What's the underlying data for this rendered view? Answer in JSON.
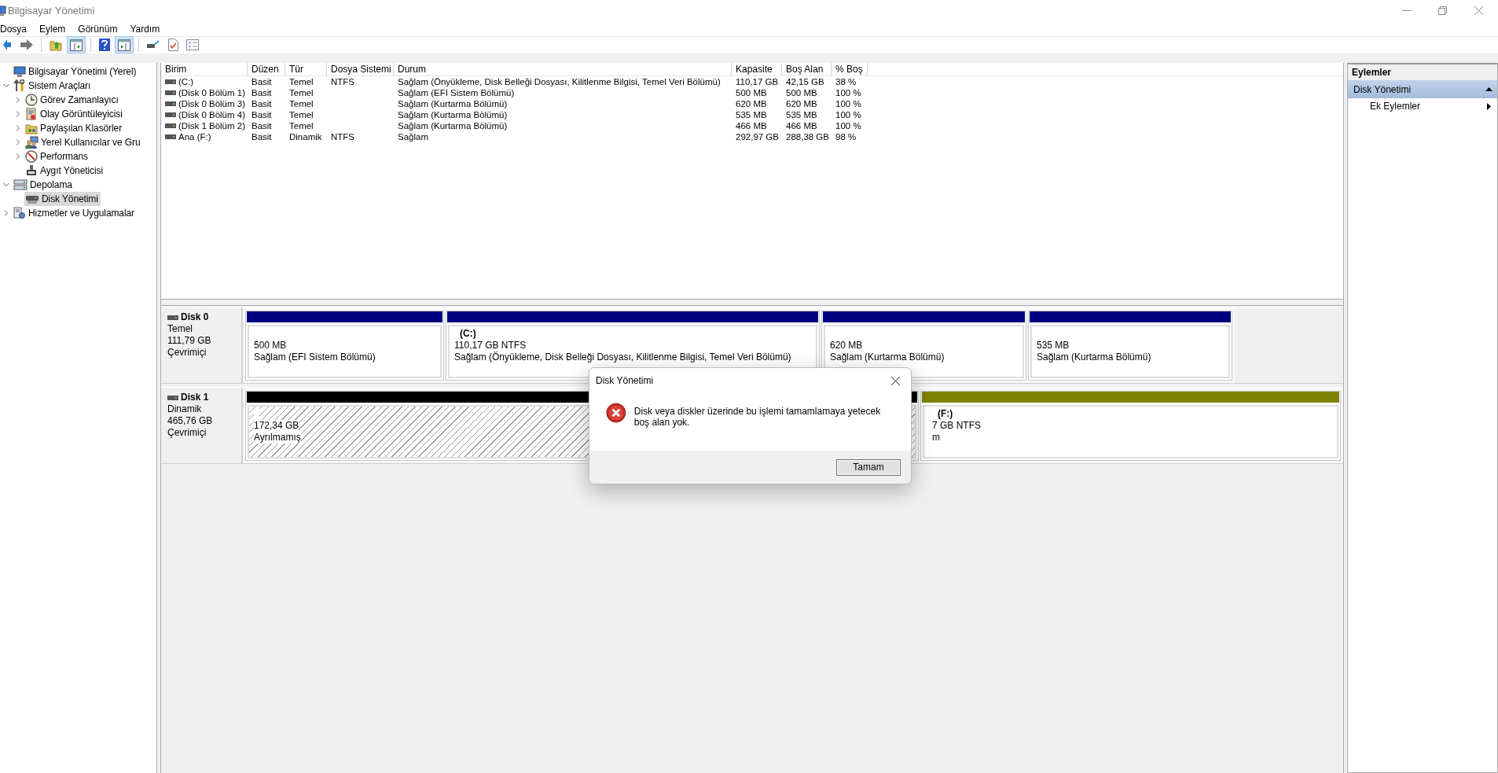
{
  "window": {
    "title": "Bilgisayar Yönetimi"
  },
  "menu": [
    "Dosya",
    "Eylem",
    "Görünüm",
    "Yardım"
  ],
  "toolbar": [
    {
      "pressed": false
    },
    {
      "pressed": false
    },
    {
      "pressed": false
    },
    {
      "pressed": true
    },
    {
      "pressed": false
    },
    {
      "pressed": true
    },
    {
      "pressed": false
    },
    {
      "pressed": false
    },
    {
      "pressed": false
    }
  ],
  "tree": [
    {
      "label": "Bilgisayar Yönetimi (Yerel)",
      "selected": false,
      "children": [
        {
          "label": "Sistem Araçları",
          "selected": false,
          "expanded": true,
          "children": [
            {
              "label": "Görev Zamanlayıcı",
              "selected": false,
              "expanded": false
            },
            {
              "label": "Olay Görüntüleyicisi",
              "selected": false,
              "expanded": false
            },
            {
              "label": "Paylaşılan Klasörler",
              "selected": false,
              "expanded": false
            },
            {
              "label": "Yerel Kullanıcılar ve Gru",
              "selected": false,
              "expanded": false
            },
            {
              "label": "Performans",
              "selected": false,
              "expanded": false
            },
            {
              "label": "Aygıt Yöneticisi",
              "selected": false
            }
          ]
        },
        {
          "label": "Depolama",
          "selected": false,
          "expanded": true,
          "children": [
            {
              "label": "Disk Yönetimi",
              "selected": true
            }
          ]
        },
        {
          "label": "Hizmetler ve Uygulamalar",
          "selected": false,
          "expanded": false
        }
      ]
    }
  ],
  "volumes": {
    "columns": [
      "Birim",
      "Düzen",
      "Tür",
      "Dosya Sistemi",
      "Durum",
      "Kapasite",
      "Boş Alan",
      "% Boş"
    ],
    "rows": [
      [
        " (C:)",
        "Basit",
        "Temel",
        "NTFS",
        "Sağlam (Önyükleme, Disk Belleği Dosyası, Kilitlenme Bilgisi, Temel Veri Bölümü)",
        "110,17 GB",
        "42,15 GB",
        "38 %"
      ],
      [
        "(Disk 0 Bölüm 1)",
        "Basit",
        "Temel",
        "",
        "Sağlam (EFI Sistem Bölümü)",
        "500 MB",
        "500 MB",
        "100 %"
      ],
      [
        "(Disk 0 Bölüm 3)",
        "Basit",
        "Temel",
        "",
        "Sağlam (Kurtarma Bölümü)",
        "620 MB",
        "620 MB",
        "100 %"
      ],
      [
        "(Disk 0 Bölüm 4)",
        "Basit",
        "Temel",
        "",
        "Sağlam (Kurtarma Bölümü)",
        "535 MB",
        "535 MB",
        "100 %"
      ],
      [
        "(Disk 1 Bölüm 2)",
        "Basit",
        "Temel",
        "",
        "Sağlam (Kurtarma Bölümü)",
        "466 MB",
        "466 MB",
        "100 %"
      ],
      [
        "Ana (F:)",
        "Basit",
        "Dinamik",
        "NTFS",
        "Sağlam",
        "292,97 GB",
        "288,38 GB",
        "98 %"
      ]
    ]
  },
  "disks": [
    {
      "name": "Disk 0",
      "type": "Temel",
      "size": "111,79 GB",
      "status": "Çevrimiçi",
      "partitions": [
        {
          "kind": "primary",
          "size": "500 MB",
          "status": "Sağlam (EFI Sistem Bölümü)"
        },
        {
          "kind": "primary",
          "title": "(C:)",
          "size": "110,17 GB NTFS",
          "status": "Sağlam (Önyükleme, Disk Belleği Dosyası, Kilitlenme Bilgisi, Temel Veri Bölümü)"
        },
        {
          "kind": "primary",
          "size": "620 MB",
          "status": "Sağlam (Kurtarma Bölümü)"
        },
        {
          "kind": "primary",
          "size": "535 MB",
          "status": "Sağlam (Kurtarma Bölümü)"
        }
      ]
    },
    {
      "name": "Disk 1",
      "type": "Dinamik",
      "size": "465,76 GB",
      "status": "Çevrimiçi",
      "partitions": [
        {
          "kind": "unallocated",
          "size": "172,34 GB",
          "status": "Ayrılmamış"
        },
        {
          "kind": "simple",
          "title": "(F:)",
          "size": "7 GB NTFS",
          "status": "m"
        }
      ]
    }
  ],
  "actions": {
    "title": "Eylemler",
    "items": [
      {
        "kind": "section",
        "label": "Disk Yönetimi",
        "expanded": true
      },
      {
        "kind": "submenu",
        "label": "Ek Eylemler"
      }
    ]
  },
  "dialog": {
    "title": "Disk Yönetimi",
    "message": "Disk veya diskler üzerinde bu işlemi tamamlamaya yetecek boş alan yok.",
    "buttons": [
      "Tamam"
    ]
  }
}
